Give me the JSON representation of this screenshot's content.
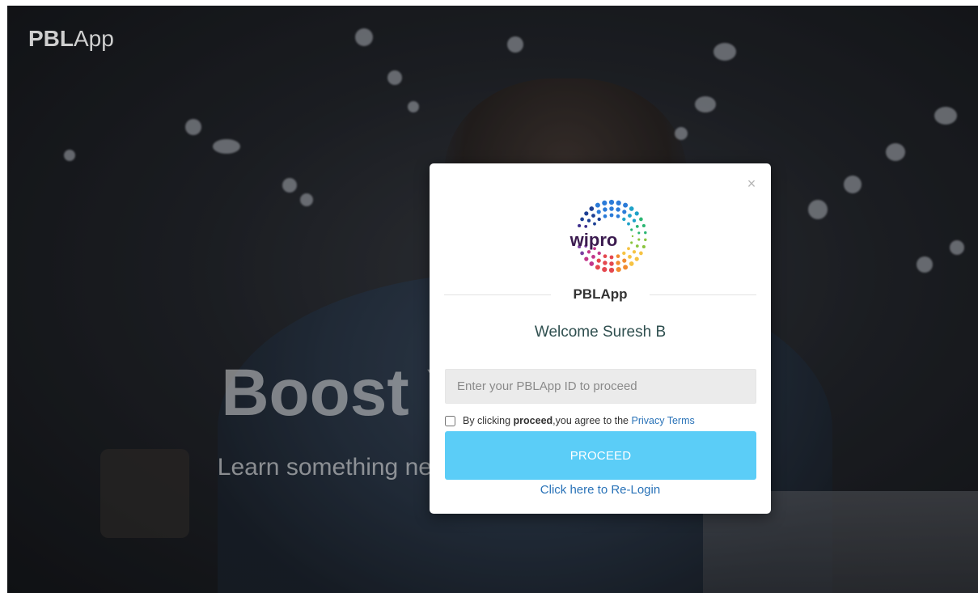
{
  "header": {
    "brand_strong": "PBL",
    "brand_rest": "App"
  },
  "hero": {
    "title": "Boost Your Skills",
    "subtitle": "Learn something new today and get inspired by the"
  },
  "modal": {
    "close_symbol": "×",
    "logo_text": "wipro",
    "app_name": "PBLApp",
    "welcome": "Welcome Suresh B",
    "id_input": {
      "placeholder": "Enter your PBLApp ID to proceed",
      "value": ""
    },
    "terms": {
      "checked": false,
      "prefix": "By clicking ",
      "bold_word": "proceed",
      "middle": ",you agree to the ",
      "link": "Privacy Terms"
    },
    "proceed_label": "PROCEED",
    "relogin_label": "Click here to Re-Login"
  },
  "icons": {
    "close": "close-icon",
    "logo": "wipro-logo"
  }
}
